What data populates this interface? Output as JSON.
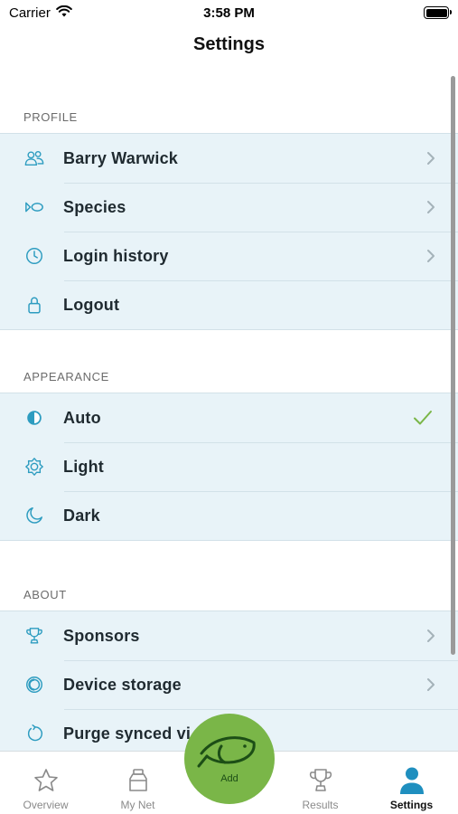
{
  "status_bar": {
    "carrier": "Carrier",
    "time": "3:58 PM"
  },
  "nav": {
    "title": "Settings"
  },
  "sections": {
    "profile": {
      "header": "PROFILE",
      "items": [
        {
          "label": "Barry Warwick",
          "icon": "users-icon",
          "accessory": "chevron"
        },
        {
          "label": "Species",
          "icon": "fish-icon",
          "accessory": "chevron"
        },
        {
          "label": "Login history",
          "icon": "clock-icon",
          "accessory": "chevron"
        },
        {
          "label": "Logout",
          "icon": "lock-icon",
          "accessory": "none"
        }
      ]
    },
    "appearance": {
      "header": "APPEARANCE",
      "selected": "Auto",
      "items": [
        {
          "label": "Auto",
          "icon": "half-circle-icon",
          "accessory": "checkmark"
        },
        {
          "label": "Light",
          "icon": "sun-icon",
          "accessory": "none"
        },
        {
          "label": "Dark",
          "icon": "moon-icon",
          "accessory": "none"
        }
      ]
    },
    "about": {
      "header": "ABOUT",
      "items": [
        {
          "label": "Sponsors",
          "icon": "trophy-icon",
          "accessory": "chevron"
        },
        {
          "label": "Device storage",
          "icon": "storage-icon",
          "accessory": "chevron"
        },
        {
          "label": "Purge synced vi",
          "icon": "purge-icon",
          "accessory": "none"
        }
      ]
    }
  },
  "tabs": [
    {
      "label": "Overview",
      "icon": "star-icon",
      "active": false
    },
    {
      "label": "My Net",
      "icon": "jar-icon",
      "active": false
    },
    {
      "label": "Add",
      "icon": "fish-icon",
      "active": false
    },
    {
      "label": "Results",
      "icon": "trophy-icon",
      "active": false
    },
    {
      "label": "Settings",
      "icon": "person-icon",
      "active": true
    }
  ],
  "colors": {
    "accent": "#2d9cc0",
    "row_background": "#e8f3f8",
    "checkmark": "#7ab648",
    "add_button": "#7ab648",
    "settings_tab_icon": "#1f8fbf"
  }
}
